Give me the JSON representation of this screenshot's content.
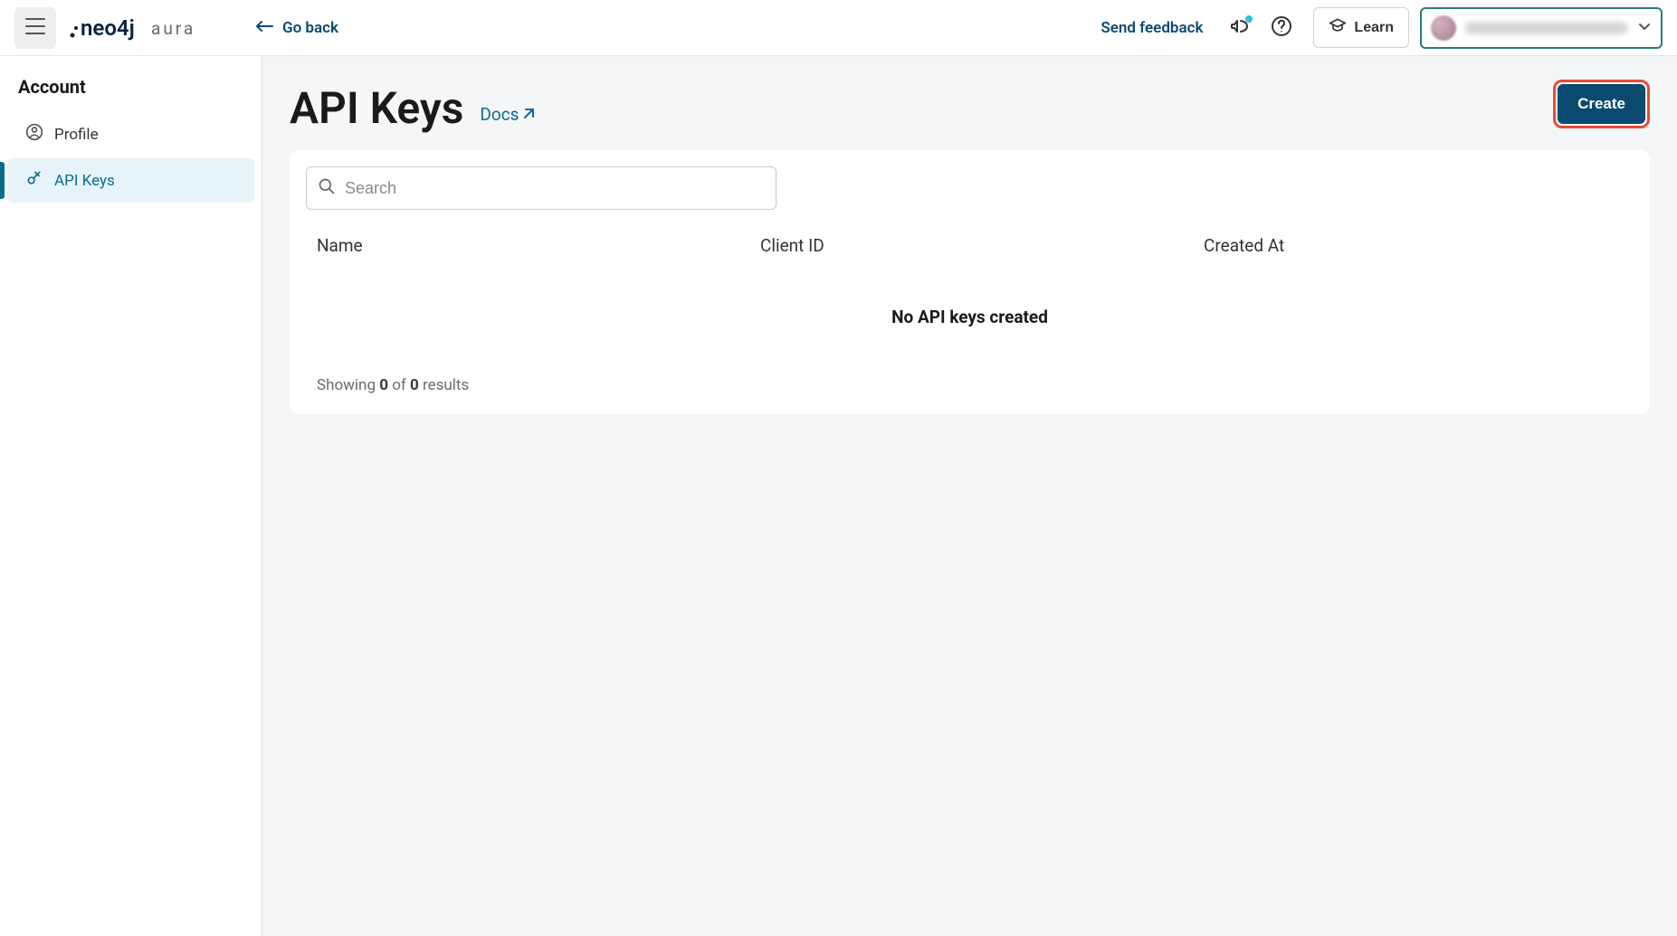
{
  "header": {
    "go_back_label": "Go back",
    "send_feedback_label": "Send feedback",
    "learn_label": "Learn"
  },
  "sidebar": {
    "title": "Account",
    "items": [
      {
        "label": "Profile"
      },
      {
        "label": "API Keys"
      }
    ]
  },
  "page": {
    "title": "API Keys",
    "docs_label": "Docs",
    "create_label": "Create",
    "search_placeholder": "Search",
    "columns": {
      "name": "Name",
      "client_id": "Client ID",
      "created_at": "Created At"
    },
    "empty_message": "No API keys created",
    "results": {
      "prefix": "Showing ",
      "count": "0",
      "of": " of ",
      "total": "0",
      "suffix": " results"
    }
  }
}
